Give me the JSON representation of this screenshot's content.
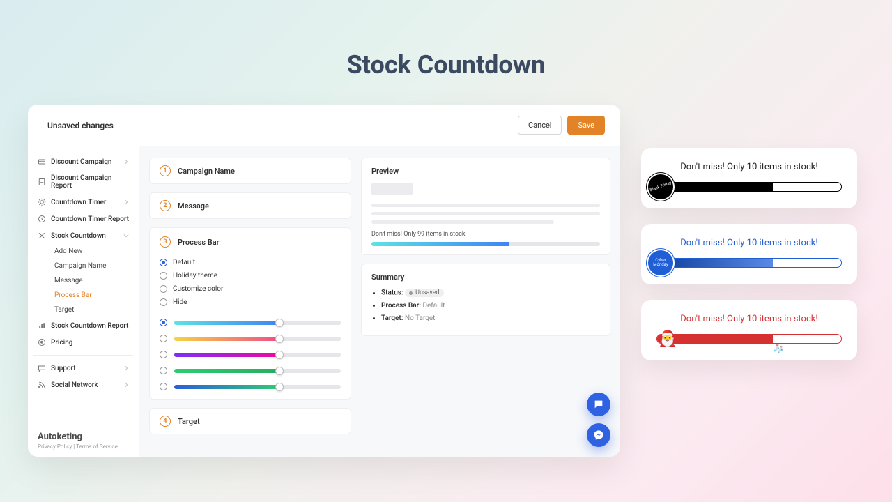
{
  "hero_title": "Stock Countdown",
  "topbar": {
    "title": "Unsaved changes",
    "cancel": "Cancel",
    "save": "Save"
  },
  "sidebar": {
    "items": [
      {
        "label": "Discount Campaign"
      },
      {
        "label": "Discount Campaign Report"
      },
      {
        "label": "Countdown Timer"
      },
      {
        "label": "Countdown Timer Report"
      },
      {
        "label": "Stock Countdown"
      },
      {
        "label": "Stock Countdown Report"
      },
      {
        "label": "Pricing"
      }
    ],
    "sub": [
      {
        "label": "Add New"
      },
      {
        "label": "Campaign Name"
      },
      {
        "label": "Message"
      },
      {
        "label": "Process Bar"
      },
      {
        "label": "Target"
      }
    ],
    "support": "Support",
    "social": "Social Network",
    "brand": "Autoketing",
    "legal": "Privacy Policy | Terms of Service"
  },
  "steps": {
    "s1": {
      "num": "1",
      "label": "Campaign Name"
    },
    "s2": {
      "num": "2",
      "label": "Message"
    },
    "s3": {
      "num": "3",
      "label": "Process Bar"
    },
    "s4": {
      "num": "4",
      "label": "Target"
    }
  },
  "process_bar": {
    "options": [
      {
        "label": "Default",
        "checked": true
      },
      {
        "label": "Holiday theme",
        "checked": false
      },
      {
        "label": "Customize color",
        "checked": false
      },
      {
        "label": "Hide",
        "checked": false
      }
    ],
    "gradients": [
      {
        "fill": "linear-gradient(90deg,#5ce2e5,#3f84f3)",
        "pct": 63,
        "checked": true
      },
      {
        "fill": "linear-gradient(90deg,#f6d344,#ef4e88)",
        "pct": 63,
        "checked": false
      },
      {
        "fill": "linear-gradient(90deg,#7b2ff7,#f107a3)",
        "pct": 63,
        "checked": false
      },
      {
        "fill": "linear-gradient(90deg,#2ecc71,#27ae60)",
        "pct": 63,
        "checked": false
      },
      {
        "fill": "linear-gradient(90deg,#2b5ce0,#2ecc71)",
        "pct": 63,
        "checked": false
      }
    ]
  },
  "preview": {
    "title": "Preview",
    "message": "Don't miss! Only 99 items in stock!"
  },
  "summary": {
    "title": "Summary",
    "rows": [
      {
        "k": "Status:",
        "v": "Unsaved",
        "badge": true
      },
      {
        "k": "Process Bar:",
        "v": "Default"
      },
      {
        "k": "Target:",
        "v": "No Target"
      }
    ]
  },
  "side_previews": [
    {
      "text": "Don't miss! Only 10 items in stock!",
      "badge": "Black Friday"
    },
    {
      "text": "Don't miss! Only 10 items in stock!",
      "badge": "Cyber Monday"
    },
    {
      "text": "Don't miss! Only 10 items in stock!",
      "badge": "🎅"
    }
  ]
}
